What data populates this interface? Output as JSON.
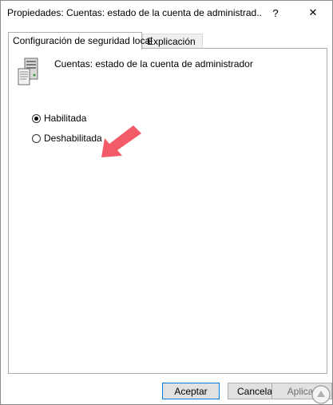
{
  "window": {
    "title": "Propiedades: Cuentas: estado de la cuenta de administrad...",
    "help_glyph": "?",
    "close_glyph": "✕"
  },
  "tabs": [
    {
      "label": "Configuración de seguridad local",
      "active": true
    },
    {
      "label": "Explicación",
      "active": false
    }
  ],
  "policy": {
    "name": "Cuentas: estado de la cuenta de administrador",
    "icon": "server-policy-icon"
  },
  "options": [
    {
      "label": "Habilitada",
      "checked": true
    },
    {
      "label": "Deshabilitada",
      "checked": false
    }
  ],
  "annotation": {
    "icon": "arrow-pointer-icon",
    "color": "#f25b67"
  },
  "buttons": {
    "ok": "Aceptar",
    "cancel": "Cancelar",
    "apply": "Aplicar"
  },
  "colors": {
    "focus_border": "#0078d7",
    "button_bg": "#e1e1e1"
  }
}
